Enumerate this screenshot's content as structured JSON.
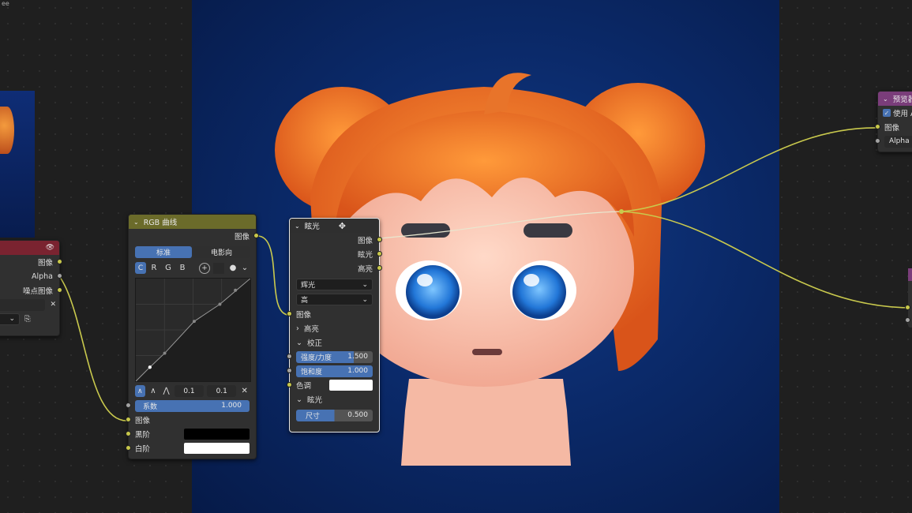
{
  "app": {
    "title_fragment": "ee"
  },
  "left_node": {
    "out_image": "图像",
    "out_alpha": "Alpha",
    "out_noisy": "噪点图像",
    "close": "✕"
  },
  "rgb_curves": {
    "title": "RGB 曲线",
    "out_image": "图像",
    "tab_standard": "标准",
    "tab_film": "电影向",
    "channels": [
      "C",
      "R",
      "G",
      "B"
    ],
    "val1": "0.1",
    "val2": "0.1",
    "factor_label": "系数",
    "factor_value": "1.000",
    "in_image": "图像",
    "black_level": "黑阶",
    "white_level": "白阶"
  },
  "glare": {
    "title": "眩光",
    "out_image": "图像",
    "out_glare": "眩光",
    "out_highlight": "高亮",
    "type_value": "辉光",
    "quality_value": "高",
    "in_image": "图像",
    "section_highlight": "高亮",
    "section_adjust": "校正",
    "strength_label": "强度/力度",
    "strength_value": "1.500",
    "saturation_label": "饱和度",
    "saturation_value": "1.000",
    "tint_label": "色调",
    "section_glare": "眩光",
    "size_label": "尺寸",
    "size_value": "0.500"
  },
  "viewer": {
    "title": "预览器",
    "use_alpha": "使用 A",
    "in_image": "图像",
    "in_alpha": "Alpha"
  },
  "colors": {
    "curve_header": "#6b6b2a",
    "viewer_header": "#7a3d7a",
    "left_header": "#7a2330",
    "socket_color": "#c8c84a",
    "blue": "#4772b3"
  }
}
